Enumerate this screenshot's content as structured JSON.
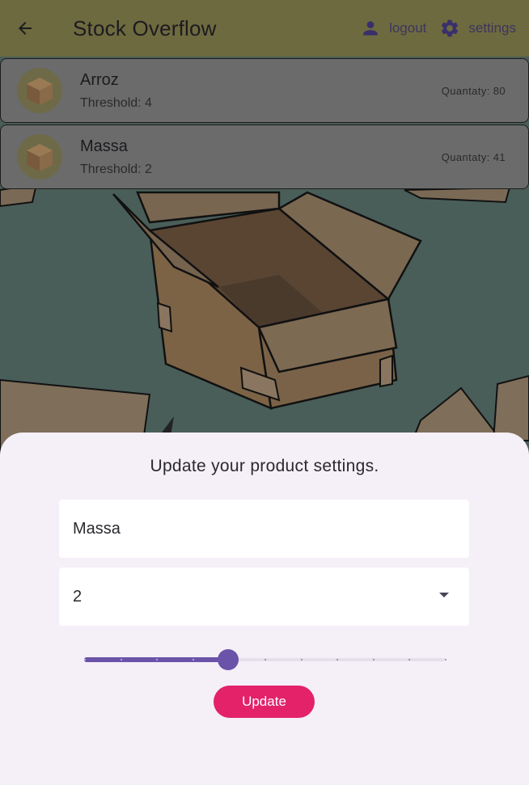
{
  "appbar": {
    "title": "Stock Overflow",
    "logout_label": "logout",
    "settings_label": "settings"
  },
  "products": [
    {
      "name": "Arroz",
      "threshold": "Threshold: 4",
      "quantity": "Quantaty: 80"
    },
    {
      "name": "Massa",
      "threshold": "Threshold: 2",
      "quantity": "Quantaty: 41"
    }
  ],
  "sheet": {
    "title": "Update your product settings.",
    "name_value": "Massa",
    "threshold_value": "2",
    "slider_value": 0.4,
    "slider_divisions": 10,
    "update_label": "Update"
  },
  "colors": {
    "appbar": "#6d6a3f",
    "accent": "#6a53a8",
    "button": "#e3226a",
    "sheet": "#f5eff7"
  },
  "icons": {
    "back": "arrow-left-icon",
    "logout": "person-icon",
    "settings": "gear-icon",
    "product": "cardboard-box-icon"
  }
}
